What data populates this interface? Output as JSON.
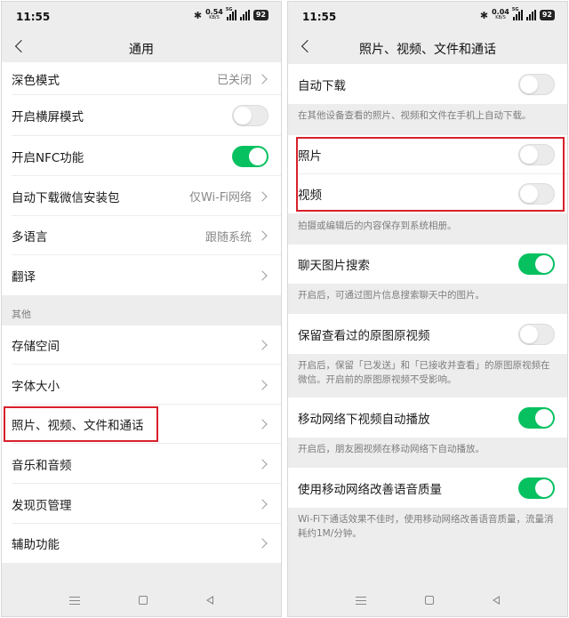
{
  "status_bar": {
    "time": "11:55",
    "bluetooth_icon": "bluetooth-icon",
    "left_speed": {
      "value": "0.54",
      "unit": "KB/S"
    },
    "right_speed": {
      "value": "0.04",
      "unit": "KB/S"
    },
    "network_tag": "5G",
    "battery": "92"
  },
  "left_screen": {
    "title": "通用",
    "rows": [
      {
        "label": "深色模式",
        "value": "已关闭"
      },
      {
        "label": "开启横屏模式"
      },
      {
        "label": "开启NFC功能"
      },
      {
        "label": "自动下载微信安装包",
        "value": "仅Wi-Fi网络"
      },
      {
        "label": "多语言",
        "value": "跟随系统"
      },
      {
        "label": "翻译"
      }
    ],
    "section_other": "其他",
    "other_rows": [
      {
        "label": "存储空间"
      },
      {
        "label": "字体大小"
      },
      {
        "label": "照片、视频、文件和通话"
      },
      {
        "label": "音乐和音频"
      },
      {
        "label": "发现页管理"
      },
      {
        "label": "辅助功能"
      }
    ],
    "toggles": {
      "landscape": false,
      "nfc": true
    }
  },
  "right_screen": {
    "title": "照片、视频、文件和通话",
    "auto_download": {
      "label": "自动下载",
      "on": false,
      "note": "在其他设备查看的照片、视频和文件在手机上自动下载。"
    },
    "photo": {
      "label": "照片",
      "on": false
    },
    "video": {
      "label": "视频",
      "on": false
    },
    "save_note": "拍摄或编辑后的内容保存到系统相册。",
    "chat_image_search": {
      "label": "聊天图片搜索",
      "on": true,
      "note": "开启后，可通过图片信息搜索聊天中的图片。"
    },
    "keep_original": {
      "label": "保留查看过的原图原视频",
      "on": false,
      "note": "开启后，保留「已发送」和「已接收并查看」的原图原视频在微信。开启前的原图原视频不受影响。"
    },
    "mobile_autoplay": {
      "label": "移动网络下视频自动播放",
      "on": true,
      "note": "开启后，朋友圈视频在移动网络下自动播放。"
    },
    "voice_quality": {
      "label": "使用移动网络改善语音质量",
      "on": true,
      "note": "Wi-Fi下通话效果不佳时，使用移动网络改善语音质量，流量消耗约1M/分钟。"
    }
  },
  "colors": {
    "accent": "#07c160",
    "highlight": "#d8212b",
    "background": "#ededed"
  }
}
